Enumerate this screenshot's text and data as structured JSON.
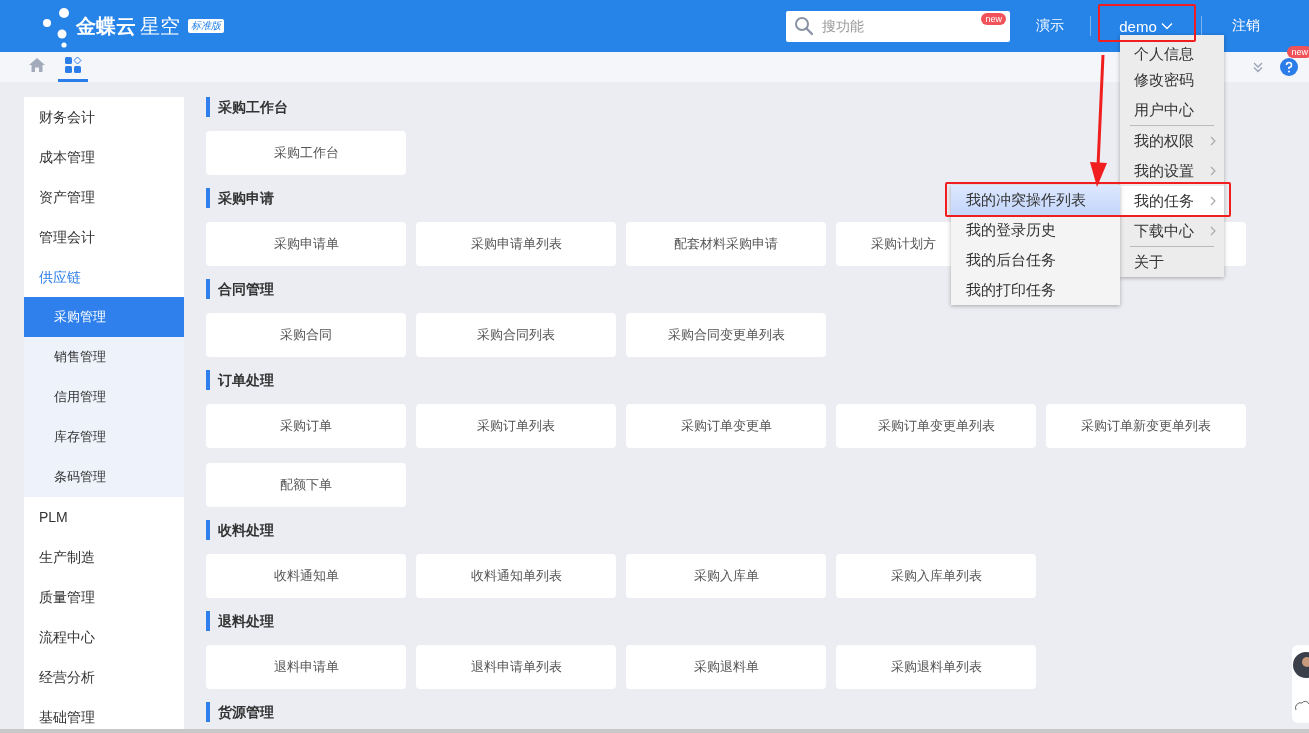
{
  "header": {
    "logo": {
      "brand": "金蝶云",
      "product": "星空",
      "edition": "标准版"
    },
    "search": {
      "placeholder": "搜功能",
      "badge": "new"
    },
    "links": [
      {
        "label": "演示",
        "dropdown": false,
        "highlighted": false
      },
      {
        "label": "demo",
        "dropdown": true,
        "highlighted": true
      },
      {
        "label": "注销",
        "dropdown": false,
        "highlighted": false
      }
    ]
  },
  "toolbar": {
    "tabs": [
      {
        "kind": "home",
        "selected": false
      },
      {
        "kind": "apps",
        "selected": true
      }
    ],
    "help_badge": "new"
  },
  "sidebar": {
    "items": [
      {
        "label": "财务会计",
        "selected": false,
        "expanded": false
      },
      {
        "label": "成本管理",
        "selected": false,
        "expanded": false
      },
      {
        "label": "资产管理",
        "selected": false,
        "expanded": false
      },
      {
        "label": "管理会计",
        "selected": false,
        "expanded": false
      },
      {
        "label": "供应链",
        "selected": false,
        "expanded": true,
        "children": [
          {
            "label": "采购管理",
            "selected": true
          },
          {
            "label": "销售管理",
            "selected": false
          },
          {
            "label": "信用管理",
            "selected": false
          },
          {
            "label": "库存管理",
            "selected": false
          },
          {
            "label": "条码管理",
            "selected": false
          }
        ]
      },
      {
        "label": "PLM",
        "selected": false,
        "expanded": false
      },
      {
        "label": "生产制造",
        "selected": false,
        "expanded": false
      },
      {
        "label": "质量管理",
        "selected": false,
        "expanded": false
      },
      {
        "label": "流程中心",
        "selected": false,
        "expanded": false
      },
      {
        "label": "经营分析",
        "selected": false,
        "expanded": false
      },
      {
        "label": "基础管理",
        "selected": false,
        "expanded": false
      }
    ]
  },
  "sections": [
    {
      "title": "采购工作台",
      "items": [
        {
          "label": "采购工作台"
        }
      ]
    },
    {
      "title": "采购申请",
      "items": [
        {
          "label": "采购申请单"
        },
        {
          "label": "采购申请单列表"
        },
        {
          "label": "配套材料采购申请"
        },
        {
          "label": "采购计划方",
          "kind": "partly_covered"
        },
        {
          "kind": "covered"
        }
      ]
    },
    {
      "title": "合同管理",
      "items": [
        {
          "label": "采购合同"
        },
        {
          "label": "采购合同列表"
        },
        {
          "label": "采购合同变更单列表"
        }
      ]
    },
    {
      "title": "订单处理",
      "items": [
        {
          "label": "采购订单"
        },
        {
          "label": "采购订单列表"
        },
        {
          "label": "采购订单变更单"
        },
        {
          "label": "采购订单变更单列表"
        },
        {
          "label": "采购订单新变更单列表"
        },
        {
          "label": "配额下单"
        }
      ]
    },
    {
      "title": "收料处理",
      "items": [
        {
          "label": "收料通知单"
        },
        {
          "label": "收料通知单列表"
        },
        {
          "label": "采购入库单"
        },
        {
          "label": "采购入库单列表"
        }
      ]
    },
    {
      "title": "退料处理",
      "items": [
        {
          "label": "退料申请单"
        },
        {
          "label": "退料申请单列表"
        },
        {
          "label": "采购退料单"
        },
        {
          "label": "采购退料单列表"
        }
      ]
    },
    {
      "title": "货源管理"
    }
  ],
  "user_menu": {
    "items": [
      {
        "kind": "item",
        "label": "个人信息",
        "submenu": false,
        "selected": false,
        "highlighted": false
      },
      {
        "kind": "item",
        "label": "修改密码",
        "submenu": false,
        "selected": false,
        "highlighted": false
      },
      {
        "kind": "item",
        "label": "用户中心",
        "submenu": false,
        "selected": false,
        "highlighted": false
      },
      {
        "kind": "divider"
      },
      {
        "kind": "item",
        "label": "我的权限",
        "submenu": true,
        "selected": false,
        "highlighted": false
      },
      {
        "kind": "item",
        "label": "我的设置",
        "submenu": true,
        "selected": false,
        "highlighted": false
      },
      {
        "kind": "item",
        "label": "我的任务",
        "submenu": true,
        "selected": true,
        "highlighted": true
      },
      {
        "kind": "item",
        "label": "下载中心",
        "submenu": true,
        "selected": false,
        "highlighted": false
      },
      {
        "kind": "divider"
      },
      {
        "kind": "item",
        "label": "关于",
        "submenu": false,
        "selected": false,
        "highlighted": false
      }
    ]
  },
  "task_submenu": {
    "items": [
      {
        "label": "我的冲突操作列表",
        "selected": true
      },
      {
        "label": "我的登录历史",
        "selected": false
      },
      {
        "label": "我的后台任务",
        "selected": false
      },
      {
        "label": "我的打印任务",
        "selected": false
      }
    ]
  }
}
